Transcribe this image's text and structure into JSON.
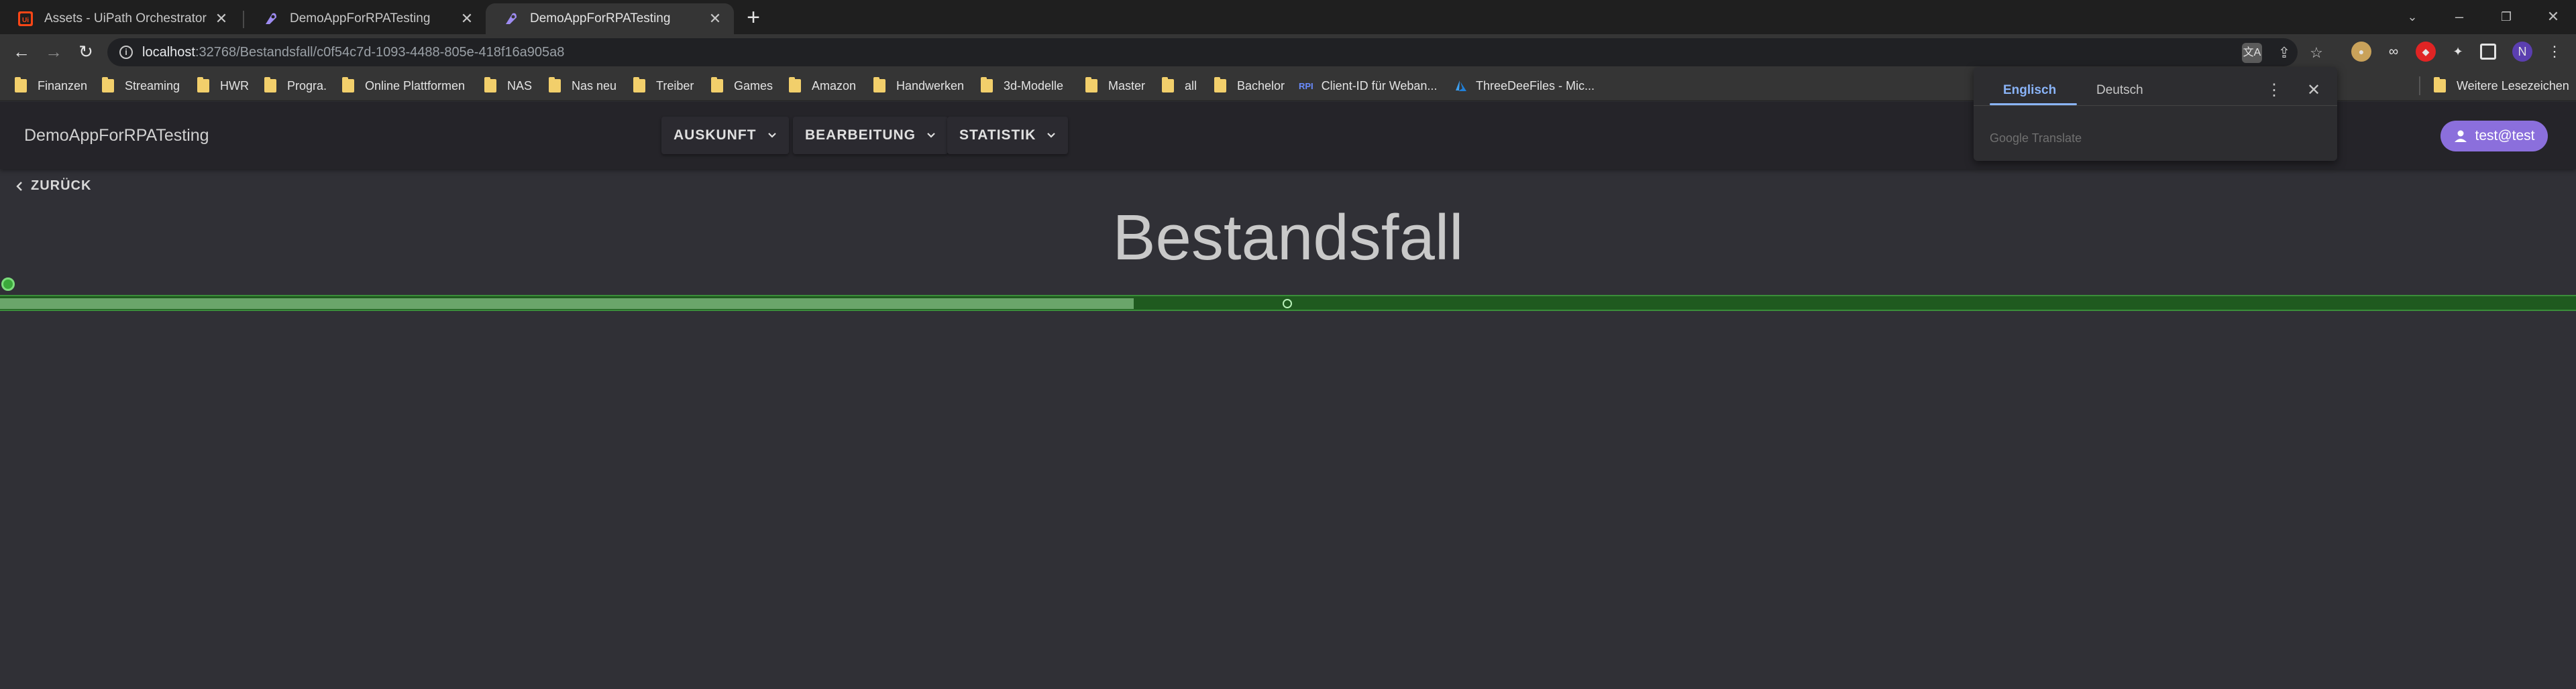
{
  "browser": {
    "tabs": [
      {
        "title": "Assets - UiPath Orchestrator",
        "favicon": "uipath-icon",
        "active": false
      },
      {
        "title": "DemoAppForRPATesting",
        "favicon": "app-icon",
        "active": false
      },
      {
        "title": "DemoAppForRPATesting",
        "favicon": "app-icon",
        "active": true
      }
    ],
    "new_tab_label": "+",
    "address": {
      "host": "localhost",
      "path": ":32768/Bestandsfall/c0f54c7d-1093-4488-805e-418f16a905a8"
    },
    "profile_initial": "N",
    "bookmarks": [
      "Finanzen",
      "Streaming",
      "HWR",
      "Progra.",
      "Online Plattformen",
      "NAS",
      "Nas neu",
      "Treiber",
      "Games",
      "Amazon",
      "Handwerken",
      "3d-Modelle",
      "Master",
      "all",
      "Bachelor",
      "Client-ID für Weban...",
      "ThreeDeeFiles - Mic..."
    ],
    "bookmark_rpa_prefix": "RPI",
    "other_bookmarks": "Weitere Lesezeichen"
  },
  "translate_popup": {
    "lang_source": "Englisch",
    "lang_target": "Deutsch",
    "brand": "Google Translate"
  },
  "app": {
    "title": "DemoAppForRPATesting",
    "menu": [
      "AUSKUNFT",
      "BEARBEITUNG",
      "STATISTIK"
    ],
    "user": "test@test",
    "back_label": "ZURÜCK",
    "page_title": "Bestandsfall",
    "progress_fraction": 0.44
  },
  "colors": {
    "accent_user": "#8b6fdc",
    "progress_track": "#1f5a1f",
    "progress_fill": "#6aa56a",
    "translate_active": "#8ab4f8"
  }
}
